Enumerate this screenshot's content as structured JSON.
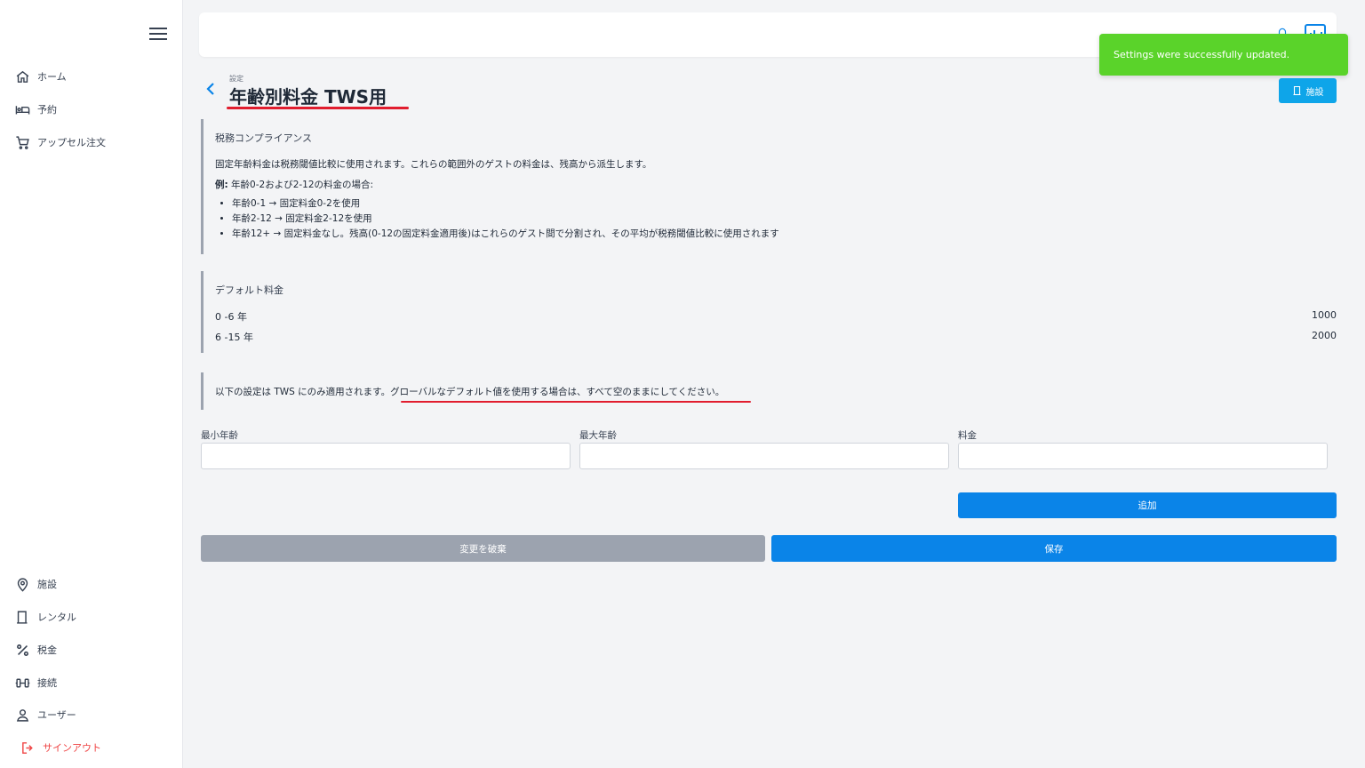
{
  "sidebar": {
    "items": [
      {
        "label": "ホーム",
        "icon": "home-icon"
      },
      {
        "label": "予約",
        "icon": "bed-icon"
      },
      {
        "label": "アップセル注文",
        "icon": "cart-icon"
      }
    ],
    "bottom_items": [
      {
        "label": "施設",
        "icon": "map-pin-icon"
      },
      {
        "label": "レンタル",
        "icon": "door-icon"
      },
      {
        "label": "税金",
        "icon": "percent-icon"
      },
      {
        "label": "接続",
        "icon": "connection-icon"
      },
      {
        "label": "ユーザー",
        "icon": "user-icon"
      }
    ],
    "signout": {
      "label": "サインアウト",
      "icon": "signout-icon"
    }
  },
  "toast": {
    "message": "Settings were successfully updated."
  },
  "header": {
    "breadcrumb": "設定",
    "title": "年齢別料金 TWS用",
    "facility_button": "施設"
  },
  "compliance": {
    "title": "税務コンプライアンス",
    "description": "固定年齢料金は税務閾値比較に使用されます。これらの範囲外のゲストの料金は、残高から派生します。",
    "example_label": "例:",
    "example_text": " 年齢0-2および2-12の料金の場合:",
    "bullets": [
      "年齢0-1 → 固定料金0-2を使用",
      "年齢2-12 → 固定料金2-12を使用",
      "年齢12+ → 固定料金なし。残高(0-12の固定料金適用後)はこれらのゲスト間で分割され、その平均が税務閾値比較に使用されます"
    ]
  },
  "defaults": {
    "title": "デフォルト料金",
    "rows": [
      {
        "range": "0 -6 年",
        "amount": "1000"
      },
      {
        "range": "6 -15 年",
        "amount": "2000"
      }
    ]
  },
  "notice": {
    "prefix": "以下の設定は TWS にのみ適用されます。",
    "highlight": "グローバルなデフォルト値を使用する場合は、すべて空のままにしてください。"
  },
  "form": {
    "min_age_label": "最小年齢",
    "max_age_label": "最大年齢",
    "price_label": "料金",
    "min_age_value": "",
    "max_age_value": "",
    "price_value": "",
    "add_button": "追加",
    "discard_button": "変更を破棄",
    "save_button": "保存"
  },
  "colors": {
    "primary": "#0a84e8",
    "toast": "#5ad32a",
    "facility_button": "#0ea5e9",
    "signout": "#ef4444",
    "annotation": "#e11d2e"
  }
}
